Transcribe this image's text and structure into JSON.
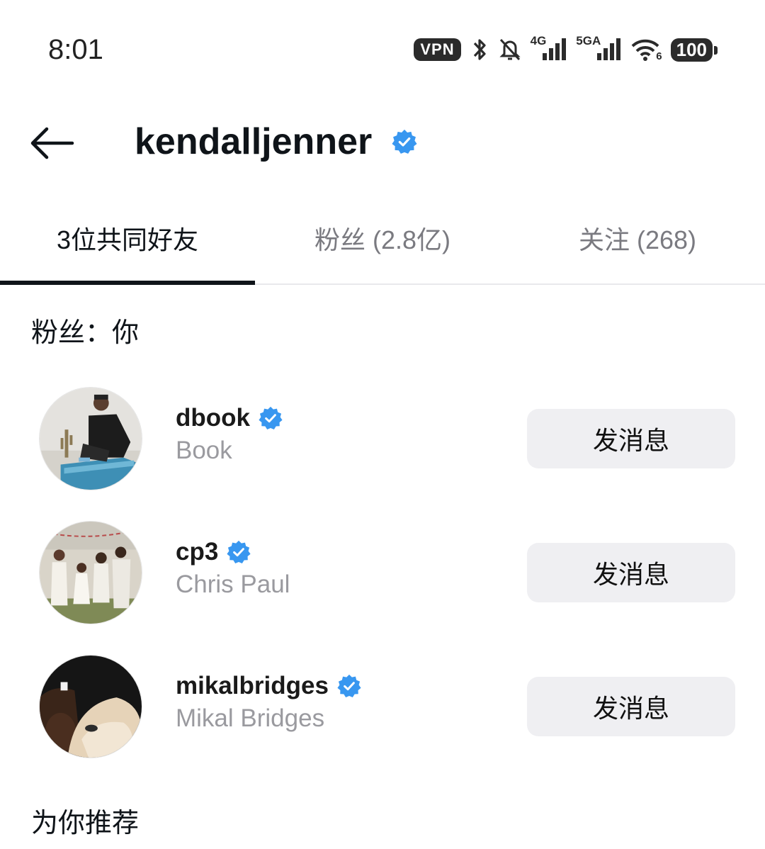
{
  "status_bar": {
    "time": "8:01",
    "vpn_label": "VPN",
    "net_4g": "4G",
    "net_5g": "5GA",
    "wifi_tag": "6",
    "battery": "100"
  },
  "header": {
    "title": "kendalljenner",
    "verified": true
  },
  "tabs": [
    {
      "label": "3位共同好友",
      "active": true
    },
    {
      "label": "粉丝 (2.8亿)",
      "active": false
    },
    {
      "label": "关注 (268)",
      "active": false
    }
  ],
  "mutual_section": {
    "title": "粉丝：你"
  },
  "users": [
    {
      "username": "dbook",
      "display_name": "Book",
      "verified": true,
      "button_label": "发消息"
    },
    {
      "username": "cp3",
      "display_name": "Chris Paul",
      "verified": true,
      "button_label": "发消息"
    },
    {
      "username": "mikalbridges",
      "display_name": "Mikal Bridges",
      "verified": true,
      "button_label": "发消息"
    }
  ],
  "recommend_section": {
    "title": "为你推荐"
  },
  "colors": {
    "verified_blue": "#3897f0",
    "tab_indicator": "#0f1419",
    "button_bg": "#efeff2",
    "secondary_text": "#9a9a9f"
  }
}
